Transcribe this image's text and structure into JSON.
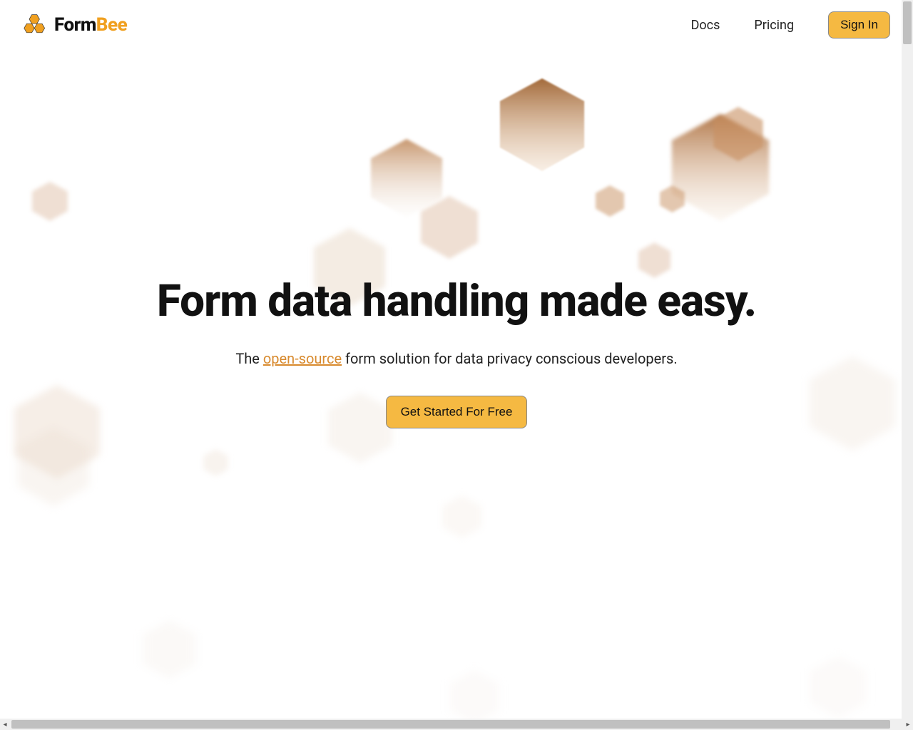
{
  "brand": {
    "name_part1": "Form",
    "name_part2": "Bee"
  },
  "nav": {
    "docs": "Docs",
    "pricing": "Pricing",
    "sign_in": "Sign In"
  },
  "hero": {
    "title": "Form data handling made easy.",
    "subtitle_prefix": "The ",
    "subtitle_link": "open-source",
    "subtitle_suffix": " form solution for data privacy conscious developers.",
    "cta": "Get Started For Free"
  },
  "colors": {
    "accent": "#f5b942",
    "brand_orange": "#f0a020"
  }
}
